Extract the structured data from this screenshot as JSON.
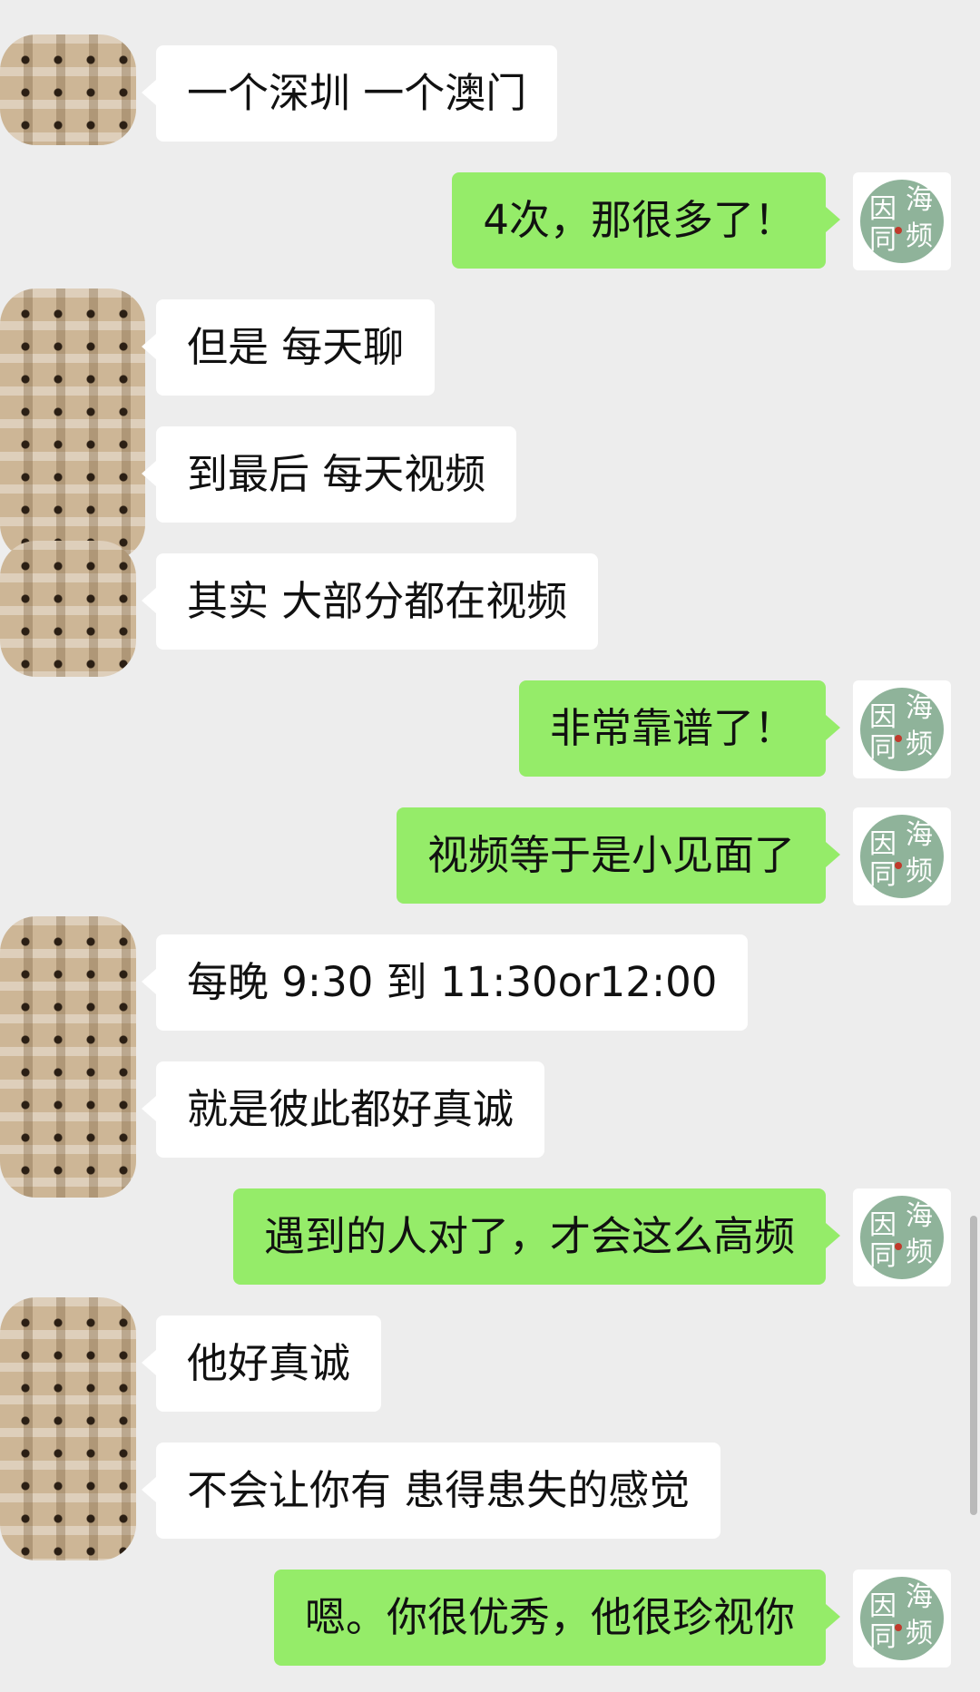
{
  "colors": {
    "background": "#ededed",
    "incoming_bubble": "#ffffff",
    "outgoing_bubble": "#95ec69",
    "self_avatar_circle": "#8fb39a",
    "contact_avatar_mosaic": "#cdb696"
  },
  "contact_avatar": {
    "icon": "pixelated-mosaic-avatar"
  },
  "self_avatar": {
    "icon": "calligraphy-seal-avatar",
    "glyphs": [
      "因",
      "海",
      "同",
      "频"
    ]
  },
  "messages": [
    {
      "side": "in",
      "text": "一个深圳 一个澳门"
    },
    {
      "side": "out",
      "text": "4次，那很多了！"
    },
    {
      "side": "in",
      "text": "但是 每天聊"
    },
    {
      "side": "in",
      "text": "到最后 每天视频"
    },
    {
      "side": "in",
      "text": "其实 大部分都在视频"
    },
    {
      "side": "out",
      "text": "非常靠谱了！"
    },
    {
      "side": "out",
      "text": "视频等于是小见面了"
    },
    {
      "side": "in",
      "text": "每晚 9:30 到 11:30or12:00"
    },
    {
      "side": "in",
      "text": "就是彼此都好真诚"
    },
    {
      "side": "out",
      "text": "遇到的人对了，才会这么高频"
    },
    {
      "side": "in",
      "text": "他好真诚"
    },
    {
      "side": "in",
      "text": "不会让你有 患得患失的感觉"
    },
    {
      "side": "out",
      "text": "嗯。你很优秀，他很珍视你"
    }
  ]
}
